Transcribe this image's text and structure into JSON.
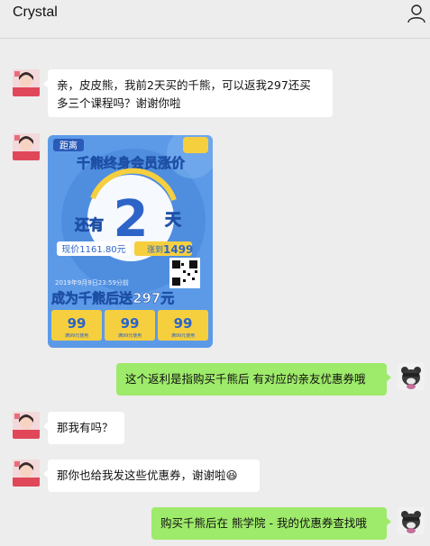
{
  "header": {
    "title": "Crystal"
  },
  "messages": [
    {
      "text1": "亲，皮皮熊，我前2天买的千熊，可以返我297还买",
      "text2": "多三个课程吗？谢谢你啦"
    },
    {
      "poster": {
        "distance_label": "距离",
        "headline": "千熊终身会员涨价",
        "still_label": "还有",
        "days": "2",
        "days_unit": "天",
        "current_price": "现价1161.80元",
        "raise_label": "涨到",
        "raise_price": "1499",
        "deadline": "2019年9月9日23:59分前",
        "promo": "成为千熊后送297元",
        "coupons": [
          {
            "value": "99",
            "note": "满99元使用"
          },
          {
            "value": "99",
            "note": "满99元使用"
          },
          {
            "value": "99",
            "note": "满99元使用"
          }
        ]
      }
    },
    {
      "text": "这个返利是指购买千熊后 有对应的亲友优惠券哦"
    },
    {
      "text": "那我有吗？"
    },
    {
      "text": "那你也给我发这些优惠券，谢谢啦",
      "emoji": "😆"
    },
    {
      "text": "购买千熊后在 熊学院 - 我的优惠券查找哦"
    }
  ]
}
